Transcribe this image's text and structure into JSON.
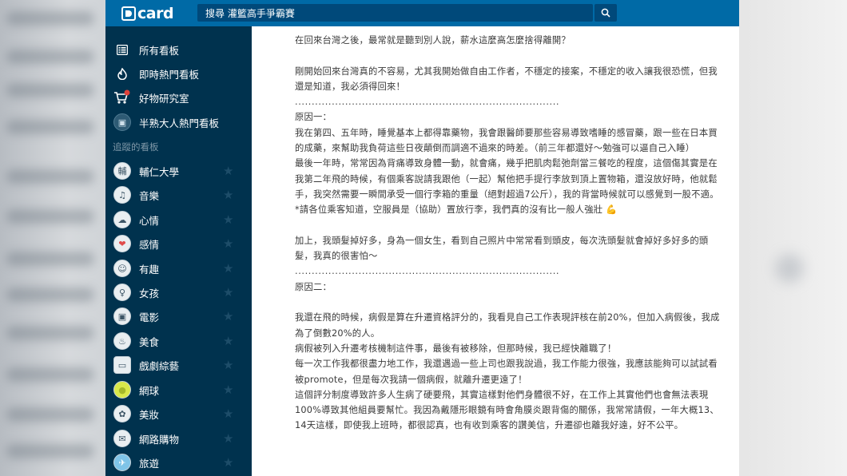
{
  "topbar": {
    "logo_text": "card",
    "search_value": "搜尋 灌籃高手爭霸賽"
  },
  "sidebar": {
    "main_items": [
      {
        "label": "所有看板",
        "icon": "list-icon"
      },
      {
        "label": "即時熱門看板",
        "icon": "flame-icon"
      },
      {
        "label": "好物研究室",
        "icon": "cart-icon"
      },
      {
        "label": "半熟大人熱門看板",
        "icon": "tv-icon"
      }
    ],
    "section_title": "追蹤的看板",
    "followed": [
      {
        "label": "輔仁大學",
        "icon": "fju-icon",
        "glyph": "輔"
      },
      {
        "label": "音樂",
        "icon": "music-icon",
        "glyph": "♫"
      },
      {
        "label": "心情",
        "icon": "mood-icon",
        "glyph": "☁"
      },
      {
        "label": "感情",
        "icon": "relationship-icon",
        "glyph": "❤"
      },
      {
        "label": "有趣",
        "icon": "funny-icon",
        "glyph": "☺"
      },
      {
        "label": "女孩",
        "icon": "girl-icon",
        "glyph": "♀"
      },
      {
        "label": "電影",
        "icon": "movie-icon",
        "glyph": "▣"
      },
      {
        "label": "美食",
        "icon": "food-icon",
        "glyph": "♨"
      },
      {
        "label": "戲劇綜藝",
        "icon": "drama-icon",
        "glyph": "▭"
      },
      {
        "label": "網球",
        "icon": "tennis-icon",
        "glyph": "●"
      },
      {
        "label": "美妝",
        "icon": "makeup-icon",
        "glyph": "✿"
      },
      {
        "label": "網路購物",
        "icon": "shopping-icon",
        "glyph": "✉"
      },
      {
        "label": "旅遊",
        "icon": "travel-icon",
        "glyph": "✈"
      }
    ]
  },
  "post": {
    "p1": "在回來台灣之後，最常就是聽到別人說，薪水這麼高怎麼捨得離開？",
    "p2": "剛開始回來台灣真的不容易，尤其我開始做自由工作者，不穩定的接案，不穩定的收入讓我很恐慌，但我還是知道，我必須得回來！",
    "divider1": "...............................................................................",
    "reason1_title": "原因一：",
    "reason1_a": "我在第四、五年時，睡覺基本上都得靠藥物，我會跟醫師要那些容易導致嗜睡的感冒藥，跟一些在日本買的成藥，來幫助我負荷這些日夜顛倒而調適不過來的時差。（前三年都還好～勉強可以逼自己入睡）",
    "reason1_b": "最後一年時，常常因為背痛導致身體一動，就會痛，幾乎把肌肉鬆弛劑當三餐吃的程度，這個傷其實是在我第二年飛的時候，有個乘客說請我跟他（一起）幫他把手提行李放到頂上置物箱，還沒放好時，他就鬆手，我突然需要一瞬間承受一個行李箱的重量（絕對超過7公斤），我的背當時候就可以感覺到一股不適。",
    "reason1_c": "*請各位乘客知道，空服員是（協助）置放行李，我們真的沒有比一般人強壯",
    "p3": "加上，我頭髮掉好多，身為一個女生，看到自己照片中常常看到頭皮，每次洗頭髮就會掉好多好多的頭髮，我真的很害怕～",
    "divider2": "...............................................................................",
    "reason2_title": "原因二：",
    "reason2_a": "我還在飛的時候，病假是算在升遷資格評分的，我看見自己工作表現評核在前20%，但加入病假後，我成為了倒數20%的人。",
    "reason2_b": "病假被列入升遷考核機制這件事，最後有被移除，但那時候，我已經快離職了！",
    "reason2_c": "每一次工作我都很盡力地工作，我還遇過一些上司也跟我說過，我工作能力很強，我應該能夠可以試試看被promote，但是每次我請一個病假，就離升遷更遠了！",
    "reason2_d": "這個評分制度導致許多人生病了硬要飛，其實這樣對他們身體很不好，在工作上其實他們也會無法表現100%導致其他組員要幫忙。我因為戴隱形眼鏡有時會角膜炎跟背傷的關係，我常常請假，一年大概13、14天這樣，即使我上班時，都很認真，也有收到乘客的讚美信，升遷卻也離我好遠，好不公平。"
  },
  "colors": {
    "topbar": "#006aa6",
    "sidebar": "#00324e",
    "search": "#00497a"
  }
}
